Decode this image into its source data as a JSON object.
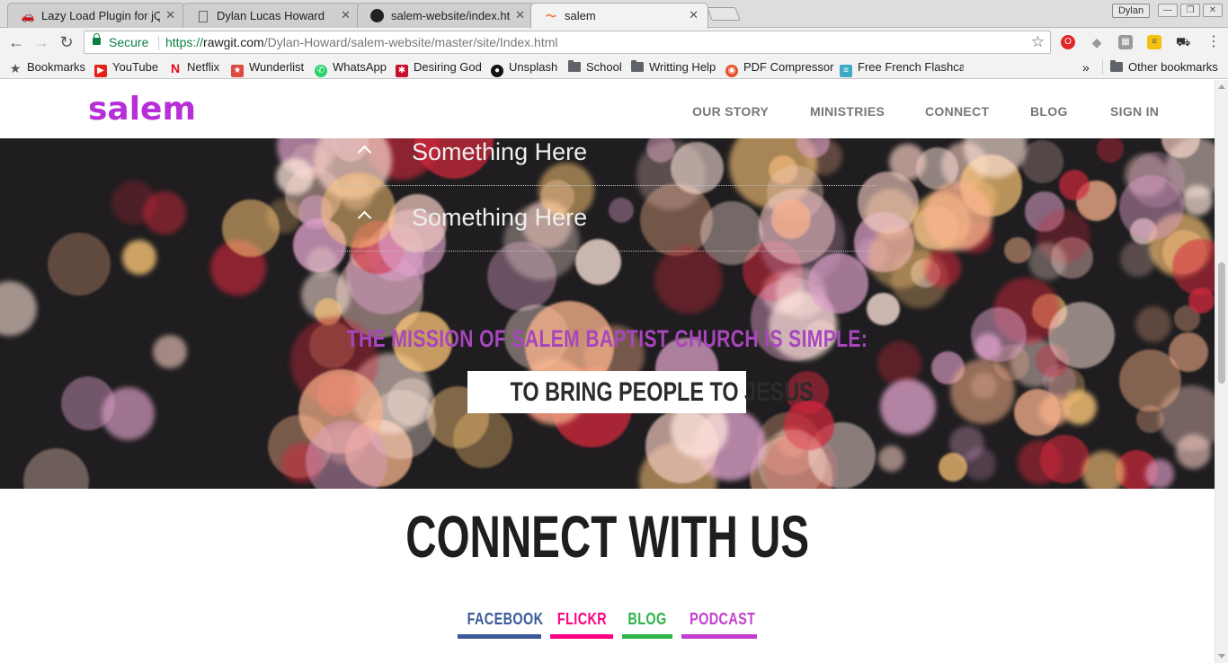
{
  "browser": {
    "tabs": [
      {
        "title": "Lazy Load Plugin for jQu",
        "icon": "plugin-icon",
        "active": false
      },
      {
        "title": "Dylan Lucas Howard",
        "icon": "document-icon",
        "active": false
      },
      {
        "title": "salem-website/index.htm",
        "icon": "github-icon",
        "active": false
      },
      {
        "title": "salem",
        "icon": "swoosh-icon",
        "active": true
      }
    ],
    "user": "Dylan",
    "window_controls": [
      "—",
      "❐",
      "✕"
    ],
    "security_label": "Secure",
    "url_scheme": "https://",
    "url_host": "rawgit.com",
    "url_path": "/Dylan-Howard/salem-website/master/site/Index.html",
    "bookmarks": [
      {
        "label": "Bookmarks",
        "icon": "star-icon"
      },
      {
        "label": "YouTube",
        "icon": "youtube-icon"
      },
      {
        "label": "Netflix",
        "icon": "netflix-icon"
      },
      {
        "label": "Wunderlist",
        "icon": "wunderlist-icon"
      },
      {
        "label": "WhatsApp",
        "icon": "whatsapp-icon"
      },
      {
        "label": "Desiring God",
        "icon": "desiring-god-icon"
      },
      {
        "label": "Unsplash",
        "icon": "camera-icon"
      },
      {
        "label": "School",
        "icon": "folder-icon"
      },
      {
        "label": "Writting Help",
        "icon": "folder-icon"
      },
      {
        "label": "PDF Compressor",
        "icon": "pdf-icon"
      },
      {
        "label": "Free French Flashcar",
        "icon": "flashcard-icon"
      }
    ],
    "overflow": "»",
    "other_bookmarks": "Other bookmarks"
  },
  "site": {
    "logo": "salem",
    "nav": [
      "OUR STORY",
      "MINISTRIES",
      "CONNECT",
      "BLOG",
      "SIGN IN"
    ],
    "accordion": [
      {
        "label": "Something Here"
      },
      {
        "label": "Something Here"
      }
    ],
    "mission_line": "THE MISSION OF SALEM BAPTIST CHURCH IS SIMPLE:",
    "mission_highlight": "TO BRING PEOPLE TO JESUS",
    "connect_title": "CONNECT WITH US",
    "social_links": [
      {
        "label": "FACEBOOK",
        "color": "#3b5998"
      },
      {
        "label": "FLICKR",
        "color": "#ff0084"
      },
      {
        "label": "BLOG",
        "color": "#2eb44a"
      },
      {
        "label": "PODCAST",
        "color": "#c33fd1"
      }
    ]
  },
  "colors": {
    "brand_purple": "#b62fd8",
    "mission_purple": "#a846bd",
    "secure_green": "#0b8043"
  }
}
